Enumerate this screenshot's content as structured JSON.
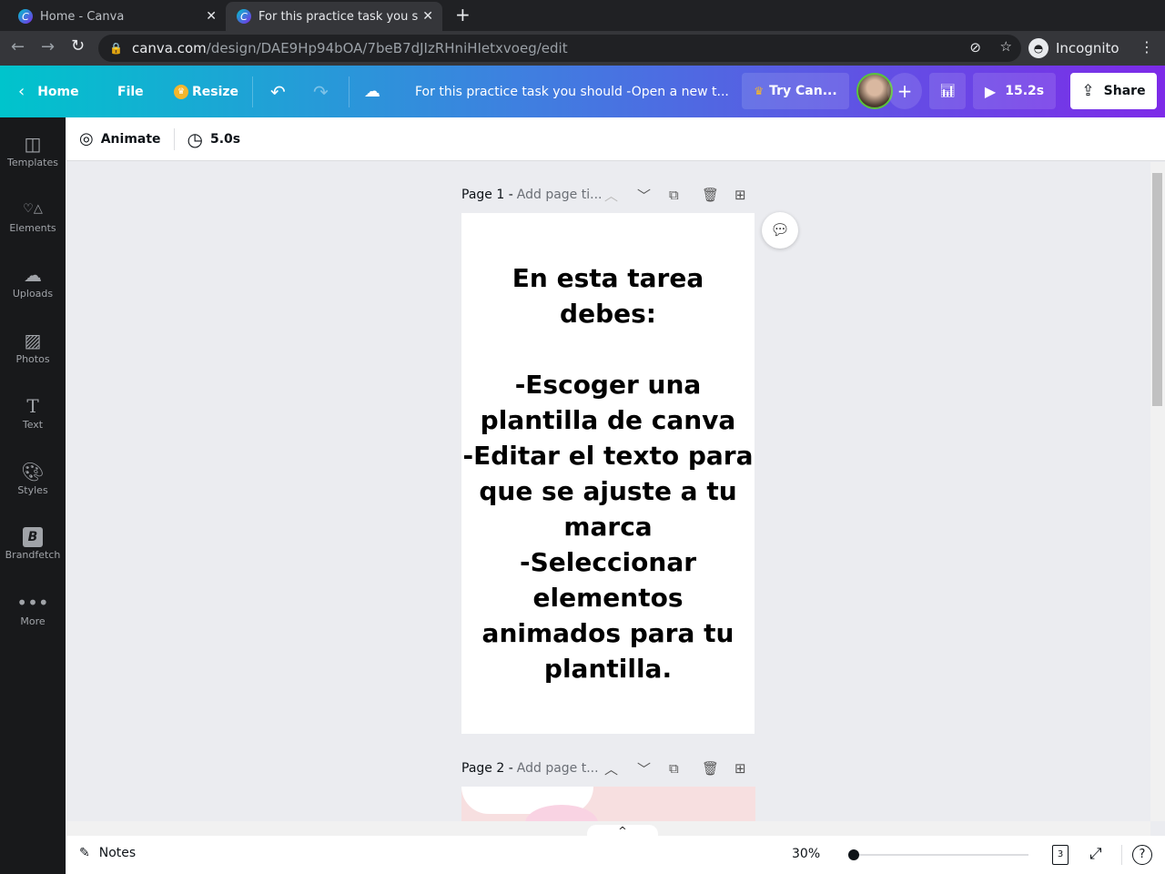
{
  "browser": {
    "tabs": [
      {
        "title": "Home - Canva"
      },
      {
        "title": "For this practice task you s"
      }
    ],
    "url_host": "canva.com",
    "url_path": "/design/DAE9Hp94bOA/7beB7dJIzRHniHIetxvoeg/edit",
    "incognito_label": "Incognito"
  },
  "header": {
    "home": "Home",
    "file": "File",
    "resize": "Resize",
    "title": "For this practice task you should -Open a new t...",
    "try": "Try Can...",
    "play_duration": "15.2s",
    "share": "Share"
  },
  "sidebar": {
    "items": [
      {
        "label": "Templates",
        "icon": "templates-icon"
      },
      {
        "label": "Elements",
        "icon": "elements-icon"
      },
      {
        "label": "Uploads",
        "icon": "uploads-icon"
      },
      {
        "label": "Photos",
        "icon": "photos-icon"
      },
      {
        "label": "Text",
        "icon": "text-icon"
      },
      {
        "label": "Styles",
        "icon": "styles-icon"
      },
      {
        "label": "Brandfetch",
        "icon": "brandfetch-icon"
      },
      {
        "label": "More",
        "icon": "more-icon"
      }
    ]
  },
  "toolbar": {
    "animate": "Animate",
    "duration": "5.0s"
  },
  "pages": [
    {
      "label": "Page 1 -",
      "title_placeholder": "Add page ti...",
      "content": "En esta tarea debes:\n\n-Escoger una plantilla de canva\n-Editar el texto para que se ajuste a tu marca\n-Seleccionar elementos animados para tu plantilla."
    },
    {
      "label": "Page 2 -",
      "title_placeholder": "Add page t..."
    }
  ],
  "footer": {
    "notes": "Notes",
    "zoom": "30%",
    "zoom_fraction": 0.0,
    "page_count": "3"
  },
  "colors": {
    "sidebar": "#18191b",
    "accent_start": "#00c4cc",
    "accent_end": "#7d2ae8"
  }
}
